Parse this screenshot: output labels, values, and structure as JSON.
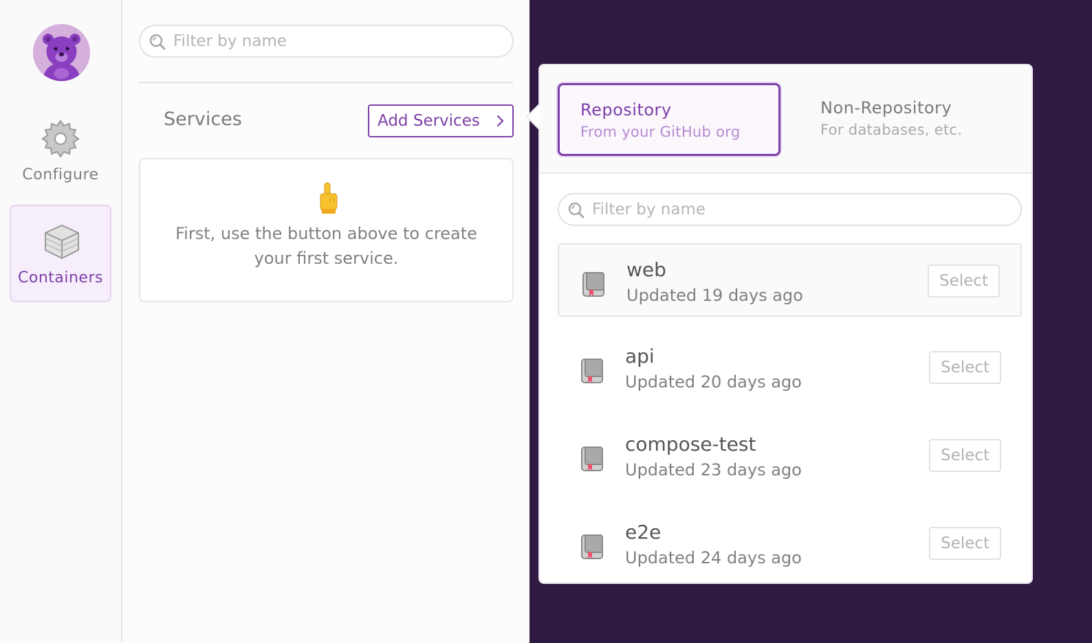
{
  "nav": {
    "avatar_icon": "bear-avatar-icon",
    "items": [
      {
        "label": "Configure",
        "icon": "gear-icon",
        "active": false
      },
      {
        "label": "Containers",
        "icon": "cube-icon",
        "active": true
      }
    ]
  },
  "services_panel": {
    "search_placeholder": "Filter by name",
    "title": "Services",
    "add_button_label": "Add Services",
    "empty_message": "First, use the button above to create your first service.",
    "empty_emoji": "pointing-up-emoji"
  },
  "popover": {
    "tabs": [
      {
        "title": "Repository",
        "subtitle": "From your GitHub org",
        "active": true
      },
      {
        "title": "Non-Repository",
        "subtitle": "For databases, etc.",
        "active": false
      }
    ],
    "search_placeholder": "Filter by name",
    "select_label": "Select",
    "repos": [
      {
        "name": "web",
        "updated": "Updated 19 days ago"
      },
      {
        "name": "api",
        "updated": "Updated 20 days ago"
      },
      {
        "name": "compose-test",
        "updated": "Updated 23 days ago"
      },
      {
        "name": "e2e",
        "updated": "Updated 24 days ago"
      }
    ]
  },
  "colors": {
    "accent": "#7d3fa8",
    "background": "#2f1b42",
    "panel": "#fcfcfc"
  }
}
